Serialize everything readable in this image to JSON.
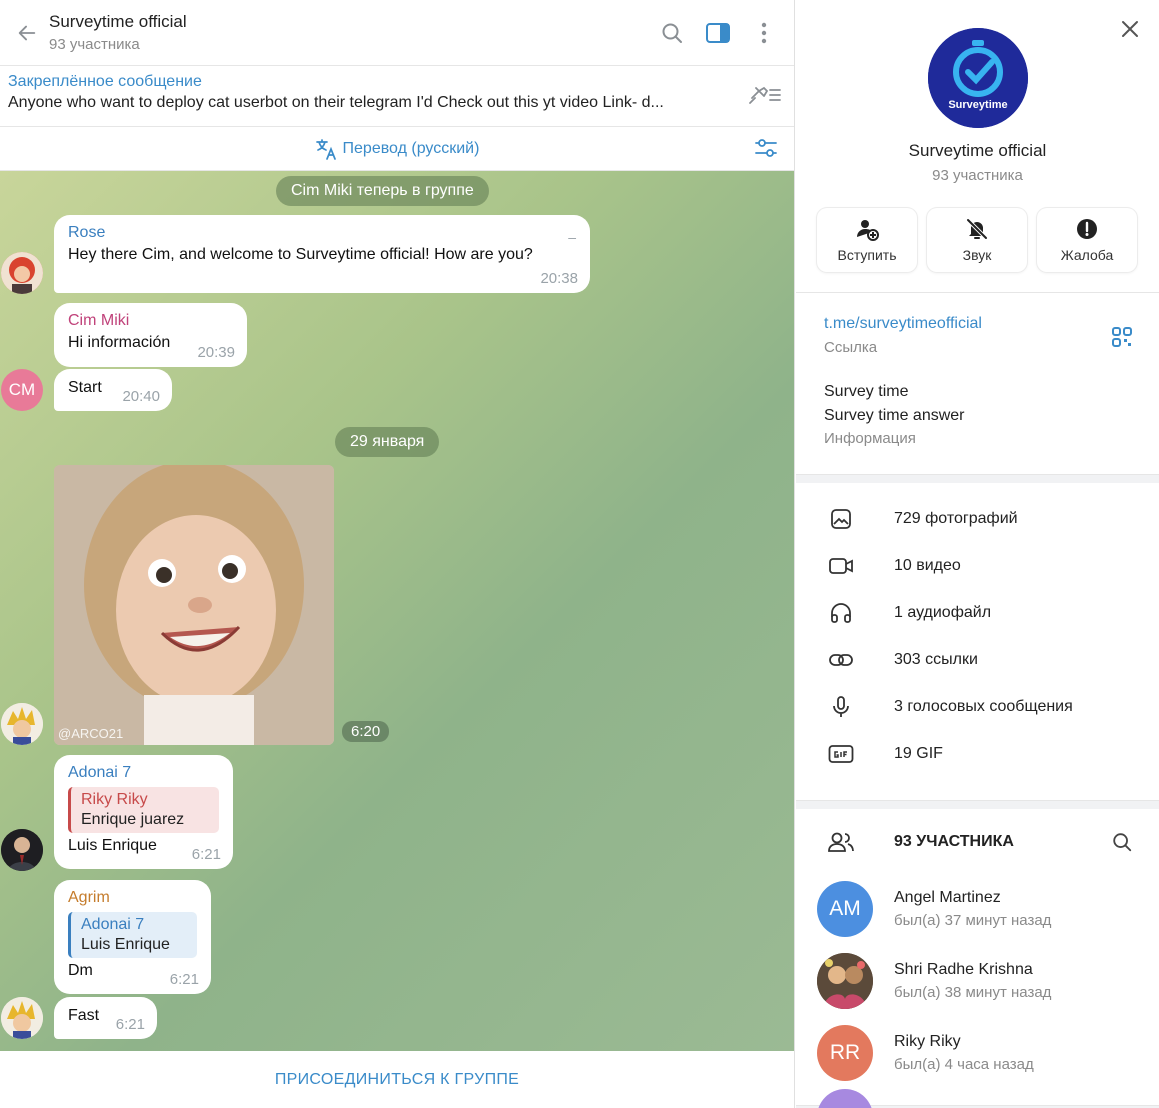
{
  "header": {
    "title": "Surveytime official",
    "subtitle": "93 участника"
  },
  "pinned": {
    "title": "Закреплённое сообщение",
    "text": "Anyone who want to deploy cat userbot on their telegram I'd  Check out this yt video   Link- d..."
  },
  "translate": {
    "label": "Перевод (русский)"
  },
  "service": {
    "joined": "Cim Miki теперь в группе",
    "date": "29 января"
  },
  "messages": [
    {
      "name": "Rose",
      "text": "Hey there Cim, and welcome to Surveytime official! How are you?",
      "time": "20:38",
      "name_color": "#3a7fbf",
      "extra": "–"
    },
    {
      "name": "Cim Miki",
      "text": "Hi información",
      "time": "20:39",
      "name_color": "#c0427a"
    },
    {
      "text": "Start",
      "time": "20:40",
      "avatar_initials": "CM"
    },
    {
      "photo_time": "6:20",
      "watermark": "@ARCO21"
    },
    {
      "name": "Adonai 7",
      "reply_name": "Riky Riky",
      "reply_text": "Enrique juarez",
      "text": "Luis Enrique",
      "time": "6:21",
      "name_color": "#3a7fbf"
    },
    {
      "name": "Agrim",
      "reply_name": "Adonai 7",
      "reply_text": "Luis Enrique",
      "text": "Dm",
      "time": "6:21",
      "name_color": "#c57c2c"
    },
    {
      "text": "Fast",
      "time": "6:21"
    }
  ],
  "bottom": {
    "join": "ПРИСОЕДИНИТЬСЯ К ГРУППЕ"
  },
  "panel": {
    "name": "Surveytime official",
    "members": "93 участника",
    "logo_text": "Surveytime",
    "actions": [
      "Вступить",
      "Звук",
      "Жалоба"
    ],
    "link": "t.me/surveytimeofficial",
    "link_caption": "Ссылка",
    "desc_line1": "Survey time",
    "desc_line2": "Survey time answer",
    "desc_caption": "Информация",
    "media": [
      "729 фотографий",
      "10 видео",
      "1 аудиофайл",
      "303 ссылки",
      "3 голосовых сообщения",
      "19 GIF"
    ],
    "members_title": "93 УЧАСТНИКА",
    "member_list": [
      {
        "name": "Angel Martinez",
        "status": "был(а) 37 минут назад",
        "initials": "AM",
        "color": "#4c8fe0"
      },
      {
        "name": "Shri Radhe Krishna",
        "status": "был(а) 38 минут назад"
      },
      {
        "name": "Riky Riky",
        "status": "был(а) 4 часа назад",
        "initials": "RR",
        "color": "#e3795e"
      }
    ]
  },
  "colors": {
    "accent": "#3a8bc9"
  }
}
